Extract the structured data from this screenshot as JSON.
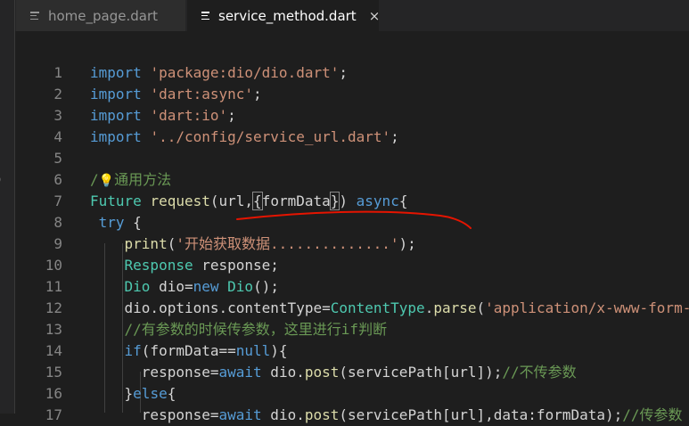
{
  "tabs": [
    {
      "label": "home_page.dart",
      "active": false
    },
    {
      "label": "service_method.dart",
      "active": true
    }
  ],
  "tab_close_glyph": "×",
  "edge_glyph": ")",
  "lines": [
    {
      "n": "1",
      "tokens": [
        {
          "t": "import",
          "c": "kw"
        },
        {
          "t": " ",
          "c": "plain"
        },
        {
          "t": "'package:dio/dio.dart'",
          "c": "str"
        },
        {
          "t": ";",
          "c": "plain"
        }
      ]
    },
    {
      "n": "2",
      "tokens": [
        {
          "t": "import",
          "c": "kw"
        },
        {
          "t": " ",
          "c": "plain"
        },
        {
          "t": "'dart:async'",
          "c": "str"
        },
        {
          "t": ";",
          "c": "plain"
        }
      ]
    },
    {
      "n": "3",
      "tokens": [
        {
          "t": "import",
          "c": "kw"
        },
        {
          "t": " ",
          "c": "plain"
        },
        {
          "t": "'dart:io'",
          "c": "str"
        },
        {
          "t": ";",
          "c": "plain"
        }
      ]
    },
    {
      "n": "4",
      "tokens": [
        {
          "t": "import",
          "c": "kw"
        },
        {
          "t": " ",
          "c": "plain"
        },
        {
          "t": "'../config/service_url.dart'",
          "c": "str"
        },
        {
          "t": ";",
          "c": "plain"
        }
      ]
    },
    {
      "n": "5",
      "tokens": []
    },
    {
      "n": "6",
      "tokens": [
        {
          "t": "/",
          "c": "cm"
        },
        {
          "t": "💡",
          "c": "bulb"
        },
        {
          "t": "通用方法",
          "c": "cm"
        }
      ]
    },
    {
      "n": "7",
      "tokens": [
        {
          "t": "Future",
          "c": "typ"
        },
        {
          "t": " ",
          "c": "plain"
        },
        {
          "t": "request",
          "c": "fn"
        },
        {
          "t": "(url,",
          "c": "plain"
        },
        {
          "t": "{",
          "c": "plain bracket-box"
        },
        {
          "t": "formData",
          "c": "plain"
        },
        {
          "t": "}",
          "c": "plain bracket-box"
        },
        {
          "t": ") ",
          "c": "plain"
        },
        {
          "t": "async",
          "c": "kw"
        },
        {
          "t": "{",
          "c": "plain"
        }
      ]
    },
    {
      "n": "8",
      "tokens": [
        {
          "t": " ",
          "c": "plain"
        },
        {
          "t": "try",
          "c": "kw"
        },
        {
          "t": " {",
          "c": "plain"
        }
      ]
    },
    {
      "n": "9",
      "tokens": [
        {
          "t": "    ",
          "c": "plain"
        },
        {
          "t": "print",
          "c": "fn"
        },
        {
          "t": "(",
          "c": "plain"
        },
        {
          "t": "'开始获取数据..............'",
          "c": "str"
        },
        {
          "t": ");",
          "c": "plain"
        }
      ]
    },
    {
      "n": "10",
      "tokens": [
        {
          "t": "    ",
          "c": "plain"
        },
        {
          "t": "Response",
          "c": "typ"
        },
        {
          "t": " response;",
          "c": "plain"
        }
      ]
    },
    {
      "n": "11",
      "tokens": [
        {
          "t": "    ",
          "c": "plain"
        },
        {
          "t": "Dio",
          "c": "typ"
        },
        {
          "t": " dio=",
          "c": "plain"
        },
        {
          "t": "new",
          "c": "kw"
        },
        {
          "t": " ",
          "c": "plain"
        },
        {
          "t": "Dio",
          "c": "typ"
        },
        {
          "t": "();",
          "c": "plain"
        }
      ]
    },
    {
      "n": "12",
      "tokens": [
        {
          "t": "    dio.options.contentType=",
          "c": "plain"
        },
        {
          "t": "ContentType",
          "c": "typ"
        },
        {
          "t": ".",
          "c": "plain"
        },
        {
          "t": "parse",
          "c": "fn"
        },
        {
          "t": "(",
          "c": "plain"
        },
        {
          "t": "'application/x-www-form-",
          "c": "str"
        }
      ]
    },
    {
      "n": "13",
      "tokens": [
        {
          "t": "    ",
          "c": "plain"
        },
        {
          "t": "//有参数的时候传参数，这里进行if判断",
          "c": "cm"
        }
      ]
    },
    {
      "n": "14",
      "tokens": [
        {
          "t": "    ",
          "c": "plain"
        },
        {
          "t": "if",
          "c": "kw"
        },
        {
          "t": "(formData==",
          "c": "plain"
        },
        {
          "t": "null",
          "c": "kw"
        },
        {
          "t": "){",
          "c": "plain"
        }
      ]
    },
    {
      "n": "15",
      "tokens": [
        {
          "t": "      response=",
          "c": "plain"
        },
        {
          "t": "await",
          "c": "kw"
        },
        {
          "t": " dio.",
          "c": "plain"
        },
        {
          "t": "post",
          "c": "fn"
        },
        {
          "t": "(servicePath[url]);",
          "c": "plain"
        },
        {
          "t": "//不传参数",
          "c": "cm"
        }
      ]
    },
    {
      "n": "16",
      "tokens": [
        {
          "t": "    }",
          "c": "plain"
        },
        {
          "t": "else",
          "c": "kw"
        },
        {
          "t": "{",
          "c": "plain"
        }
      ]
    },
    {
      "n": "17",
      "tokens": [
        {
          "t": "      response=",
          "c": "plain"
        },
        {
          "t": "await",
          "c": "kw"
        },
        {
          "t": " dio.",
          "c": "plain"
        },
        {
          "t": "post",
          "c": "fn"
        },
        {
          "t": "(servicePath[url],data:formData);",
          "c": "plain"
        },
        {
          "t": "//传参数",
          "c": "cm"
        }
      ]
    }
  ],
  "colors": {
    "background": "#1e1e1e",
    "keyword": "#569cd6",
    "string": "#ce9178",
    "type": "#4ec9b0",
    "function": "#dcdcaa",
    "comment": "#6a9955",
    "annotation": "#e51400"
  }
}
